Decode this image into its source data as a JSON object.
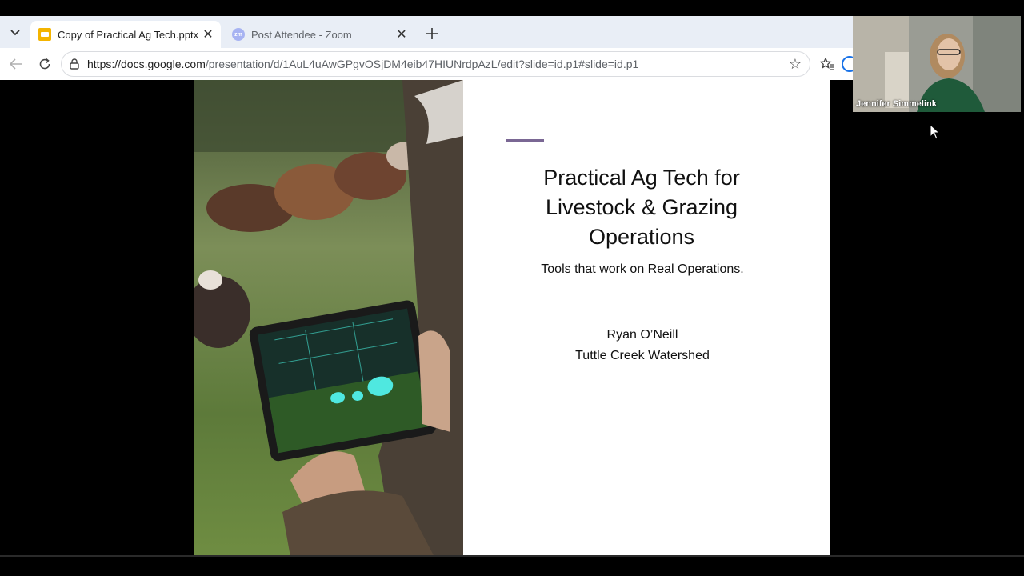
{
  "browser": {
    "tabs": [
      {
        "title": "Copy of Practical Ag Tech.pptx - G",
        "favicon": "google-slides-icon",
        "active": true
      },
      {
        "title": "Post Attendee - Zoom",
        "favicon": "zoom-icon",
        "favicon_text": "zm",
        "active": false
      }
    ],
    "url_host": "https://docs.google.com",
    "url_path": "/presentation/d/1AuL4uAwGPgvOSjDM4eib47HIUNrdpAzL/edit?slide=id.p1#slide=id.p1"
  },
  "slide": {
    "title_line1": "Practical Ag Tech for",
    "title_line2": "Livestock & Grazing",
    "title_line3": "Operations",
    "subtitle": "Tools that work on Real Operations.",
    "author_name": "Ryan O’Neill",
    "author_org": "Tuttle Creek Watershed",
    "accent_color": "#7a6794"
  },
  "video": {
    "participant_name": "Jennifer Simmelink"
  }
}
